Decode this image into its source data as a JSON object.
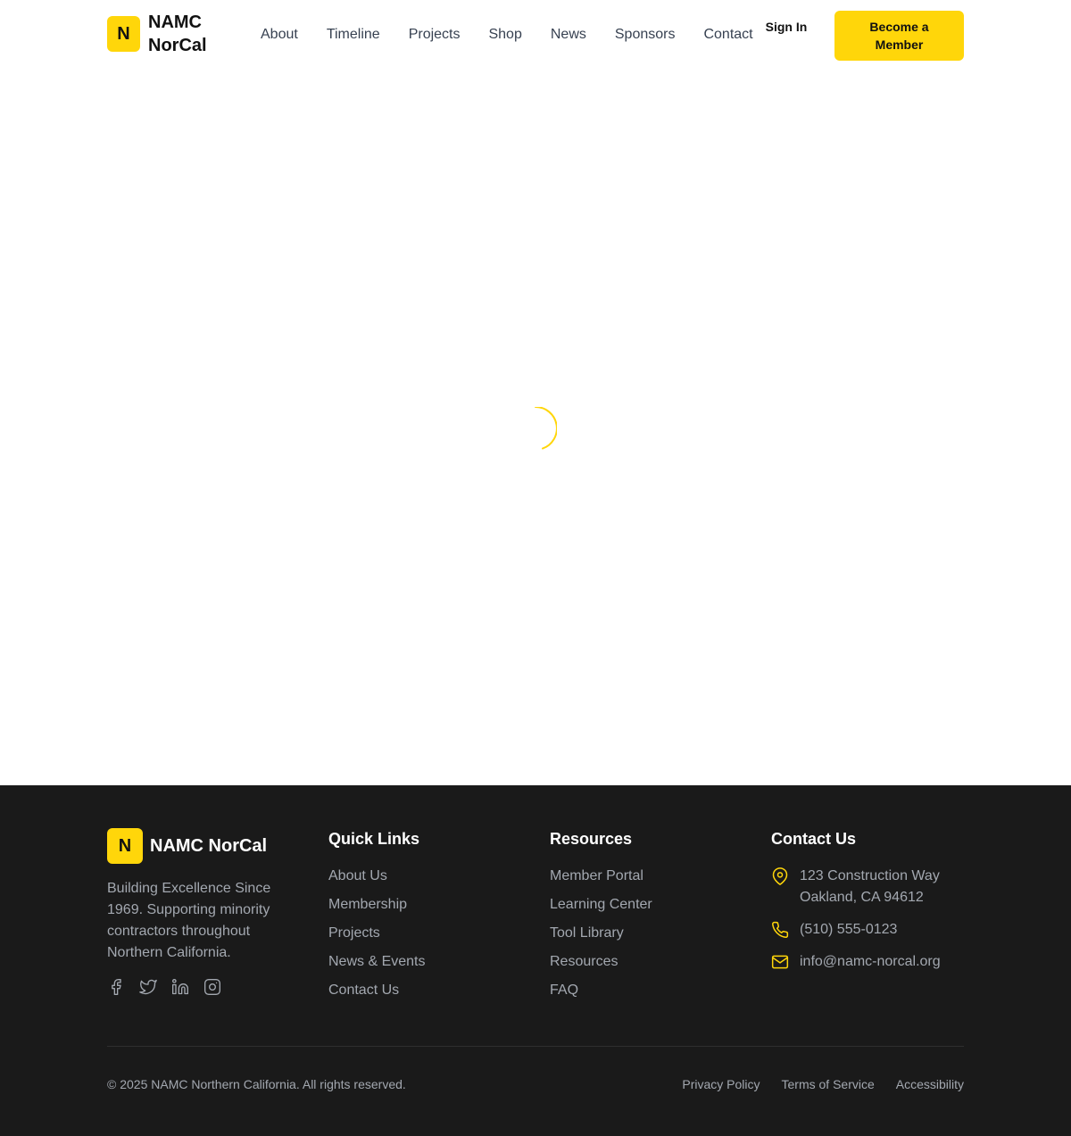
{
  "header": {
    "logo_letter": "N",
    "logo_text": "NAMC NorCal",
    "nav": [
      "About",
      "Timeline",
      "Projects",
      "Shop",
      "News",
      "Sponsors",
      "Contact"
    ],
    "signin": "Sign In",
    "cta": "Become a Member"
  },
  "colors": {
    "accent": "#FFD60A",
    "footer_bg": "#1a1a1a",
    "muted_text": "#a3a8b0"
  },
  "loading": {
    "icon": "loading-spinner-icon"
  },
  "footer": {
    "logo_letter": "N",
    "logo_text": "NAMC NorCal",
    "description": "Building Excellence Since 1969. Supporting minority contractors throughout Northern California.",
    "socials": [
      "facebook-icon",
      "twitter-icon",
      "linkedin-icon",
      "instagram-icon"
    ],
    "quick_links": {
      "title": "Quick Links",
      "items": [
        "About Us",
        "Membership",
        "Projects",
        "News & Events",
        "Contact Us"
      ]
    },
    "resources": {
      "title": "Resources",
      "items": [
        "Member Portal",
        "Learning Center",
        "Tool Library",
        "Resources",
        "FAQ"
      ]
    },
    "contact": {
      "title": "Contact Us",
      "address_line1": "123 Construction Way",
      "address_line2": "Oakland, CA 94612",
      "phone": "(510) 555-0123",
      "email": "info@namc-norcal.org"
    },
    "copyright": "© 2025 NAMC Northern California. All rights reserved.",
    "legal": [
      "Privacy Policy",
      "Terms of Service",
      "Accessibility"
    ]
  }
}
